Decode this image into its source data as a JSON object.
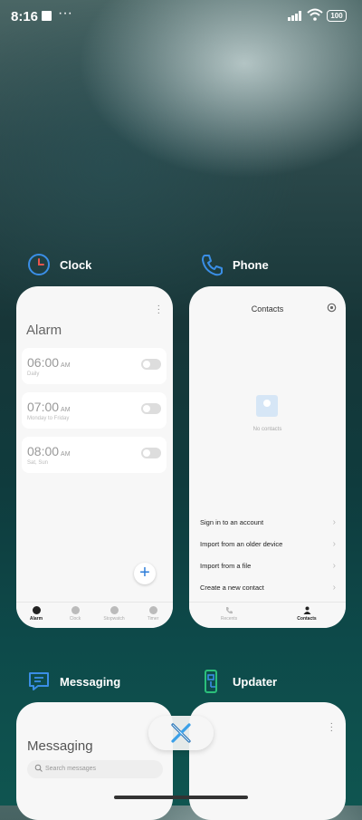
{
  "status_bar": {
    "time": "8:16",
    "more": "···",
    "battery": "100"
  },
  "recents": [
    {
      "app_name": "Clock",
      "icon": "clock-icon",
      "screen": {
        "title": "Alarm",
        "alarms": [
          {
            "time": "06:00",
            "ampm": "AM",
            "repeat": "Daily",
            "enabled": false
          },
          {
            "time": "07:00",
            "ampm": "AM",
            "repeat": "Monday to Friday",
            "enabled": false
          },
          {
            "time": "08:00",
            "ampm": "AM",
            "repeat": "Sat, Sun",
            "enabled": false
          }
        ],
        "tabs": [
          "Alarm",
          "Clock",
          "Stopwatch",
          "Timer"
        ],
        "active_tab": "Alarm"
      }
    },
    {
      "app_name": "Phone",
      "icon": "phone-icon",
      "screen": {
        "title": "Contacts",
        "empty_text": "No contacts",
        "actions": [
          "Sign in to an account",
          "Import from an older device",
          "Import from a file",
          "Create a new contact"
        ],
        "tabs": [
          "Recents",
          "Contacts"
        ],
        "active_tab": "Contacts"
      }
    },
    {
      "app_name": "Messaging",
      "icon": "messaging-icon",
      "screen": {
        "title": "Messaging",
        "search_placeholder": "Search messages"
      }
    },
    {
      "app_name": "Updater",
      "icon": "updater-icon",
      "screen": {}
    }
  ],
  "colors": {
    "accent": "#2b7bd8",
    "icon_blue": "#3a8ee6"
  }
}
